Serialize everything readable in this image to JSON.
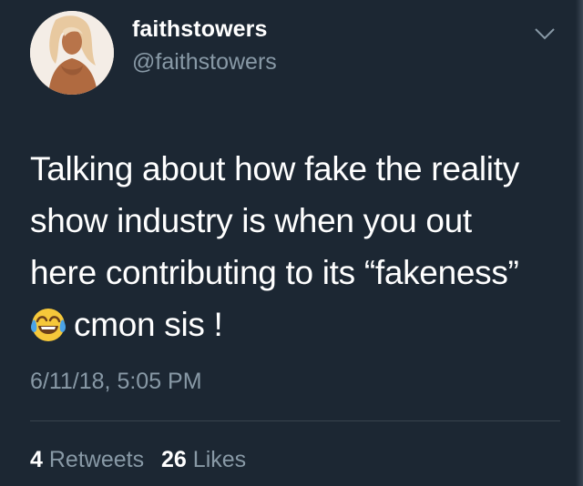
{
  "user": {
    "display_name": "faithstowers",
    "handle": "@faithstowers"
  },
  "tweet": {
    "lines": [
      "Talking about how fake the reality",
      "show industry is when you out",
      "here contributing to its “fakeness”",
      "cmon sis !"
    ],
    "emoji": "face-with-tears-of-joy",
    "timestamp": "6/11/18, 5:05 PM"
  },
  "stats": {
    "retweets_count": "4",
    "retweets_label": "Retweets",
    "likes_count": "26",
    "likes_label": "Likes"
  },
  "colors": {
    "background": "#1c2733",
    "text": "#ffffff",
    "secondary_text": "#8899a6",
    "divider": "#38444d"
  }
}
